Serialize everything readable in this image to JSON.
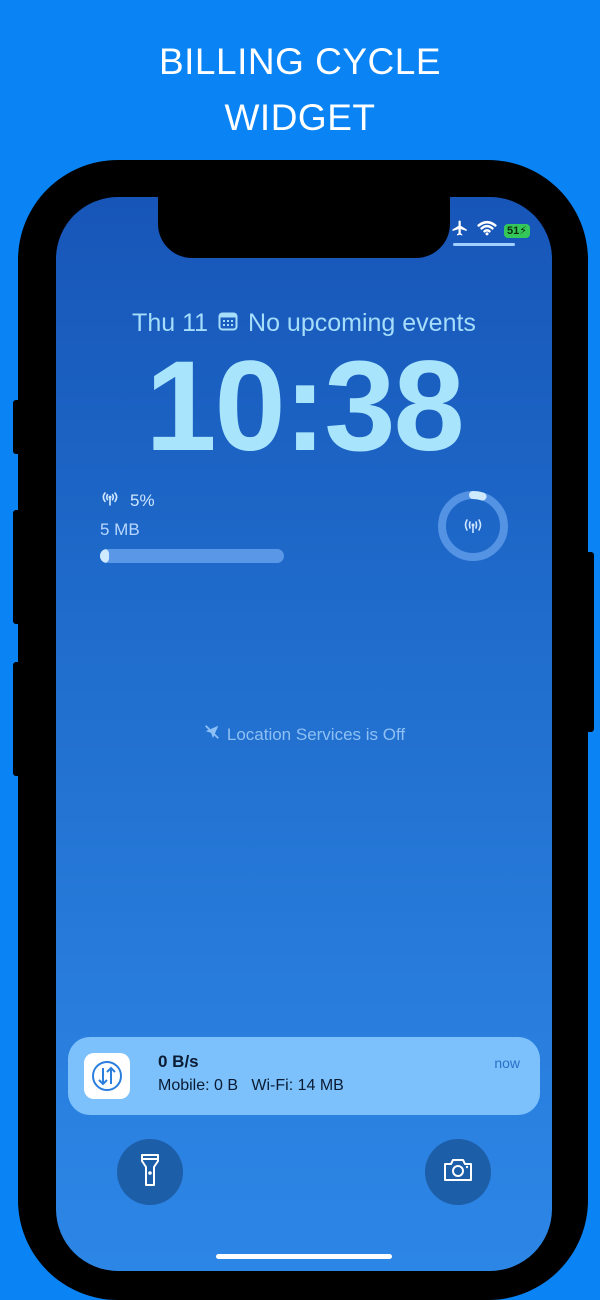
{
  "promo": {
    "line1": "BILLING CYCLE",
    "line2": "WIDGET"
  },
  "status_bar": {
    "icons": [
      "airplane-icon",
      "wifi-icon",
      "battery-icon"
    ],
    "battery_level": "51"
  },
  "lock_screen": {
    "day": "Thu 11",
    "events": "No upcoming events",
    "time": "10:38",
    "location_status": "Location Services is Off"
  },
  "data_widget": {
    "percent": "5%",
    "usage": "5 MB",
    "progress_fraction": 0.05,
    "ring_fraction": 0.05
  },
  "notification": {
    "title": "0 B/s",
    "body": "Mobile: 0 B   Wi-Fi: 14 MB",
    "time": "now"
  },
  "quick_actions": {
    "left": "flashlight-icon",
    "right": "camera-icon"
  },
  "colors": {
    "background": "#0a84f5",
    "clock": "#a9e4fd",
    "notification": "#7cc1fb",
    "battery": "#34c759"
  }
}
